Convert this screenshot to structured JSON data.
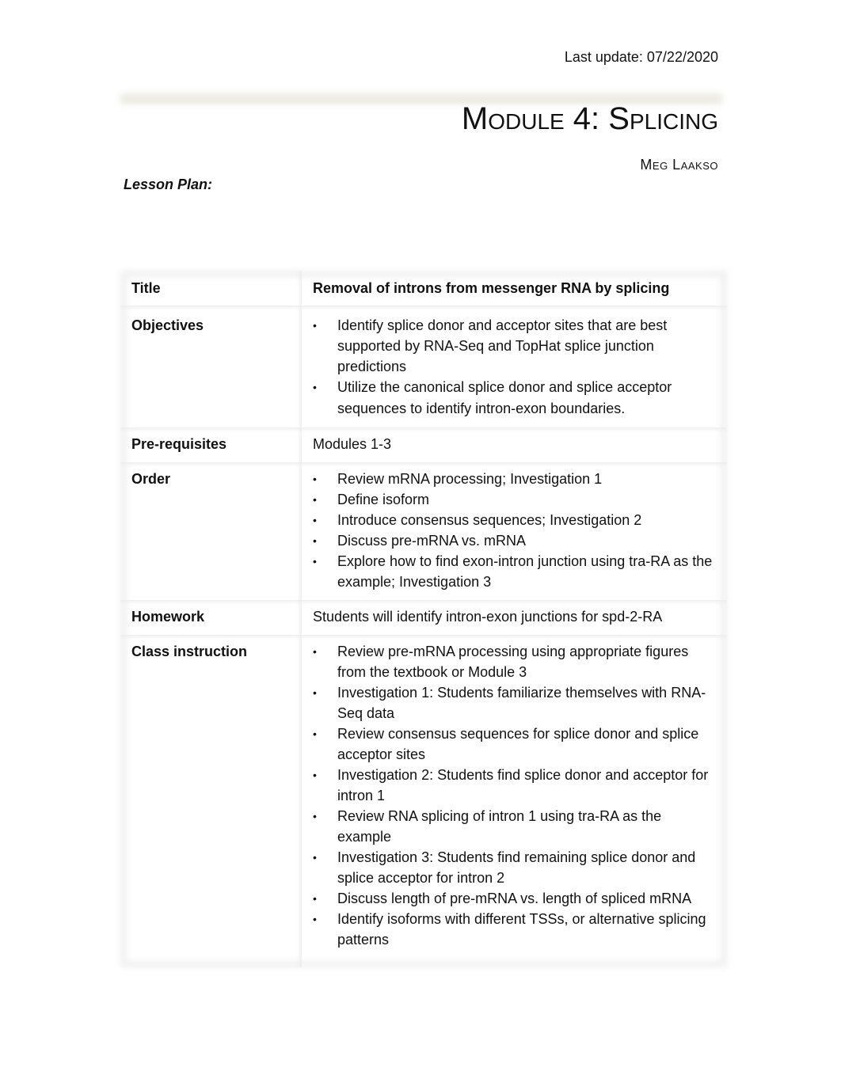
{
  "header": {
    "last_update": "Last update: 07/22/2020",
    "title": "Module 4: Splicing",
    "author": "Meg Laakso",
    "section_label": "Lesson Plan:"
  },
  "lesson_table": {
    "rows": [
      {
        "label": "Title",
        "value": "Removal of introns from messenger RNA by splicing"
      },
      {
        "label": "Objectives",
        "items": [
          "Identify splice donor and acceptor sites that are best supported by RNA-Seq and TopHat splice junction predictions",
          "Utilize the canonical splice donor and splice acceptor sequences to identify intron-exon boundaries."
        ]
      },
      {
        "label": "Pre-requisites",
        "value": "Modules 1-3"
      },
      {
        "label": "Order",
        "items": [
          "Review mRNA processing; Investigation 1",
          "Define isoform",
          "Introduce consensus sequences; Investigation 2",
          "Discuss pre-mRNA vs. mRNA",
          "Explore how to find exon-intron junction using tra-RA as the example; Investigation 3"
        ]
      },
      {
        "label": "Homework",
        "value": "Students will identify intron-exon junctions for spd-2-RA"
      },
      {
        "label": "Class instruction",
        "items": [
          "Review pre-mRNA processing using appropriate figures from the textbook or Module 3",
          "Investigation 1: Students familiarize themselves with RNA-Seq data",
          "Review consensus sequences for splice donor and splice acceptor sites",
          "Investigation 2: Students find splice donor and acceptor for intron 1",
          "Review RNA splicing of intron 1 using tra-RA as the example",
          "Investigation 3: Students find remaining splice donor and splice acceptor for intron 2",
          "Discuss length of pre-mRNA vs. length of spliced mRNA",
          "Identify isoforms with different TSSs, or alternative splicing patterns"
        ]
      }
    ],
    "bullet_glyph": "•"
  }
}
